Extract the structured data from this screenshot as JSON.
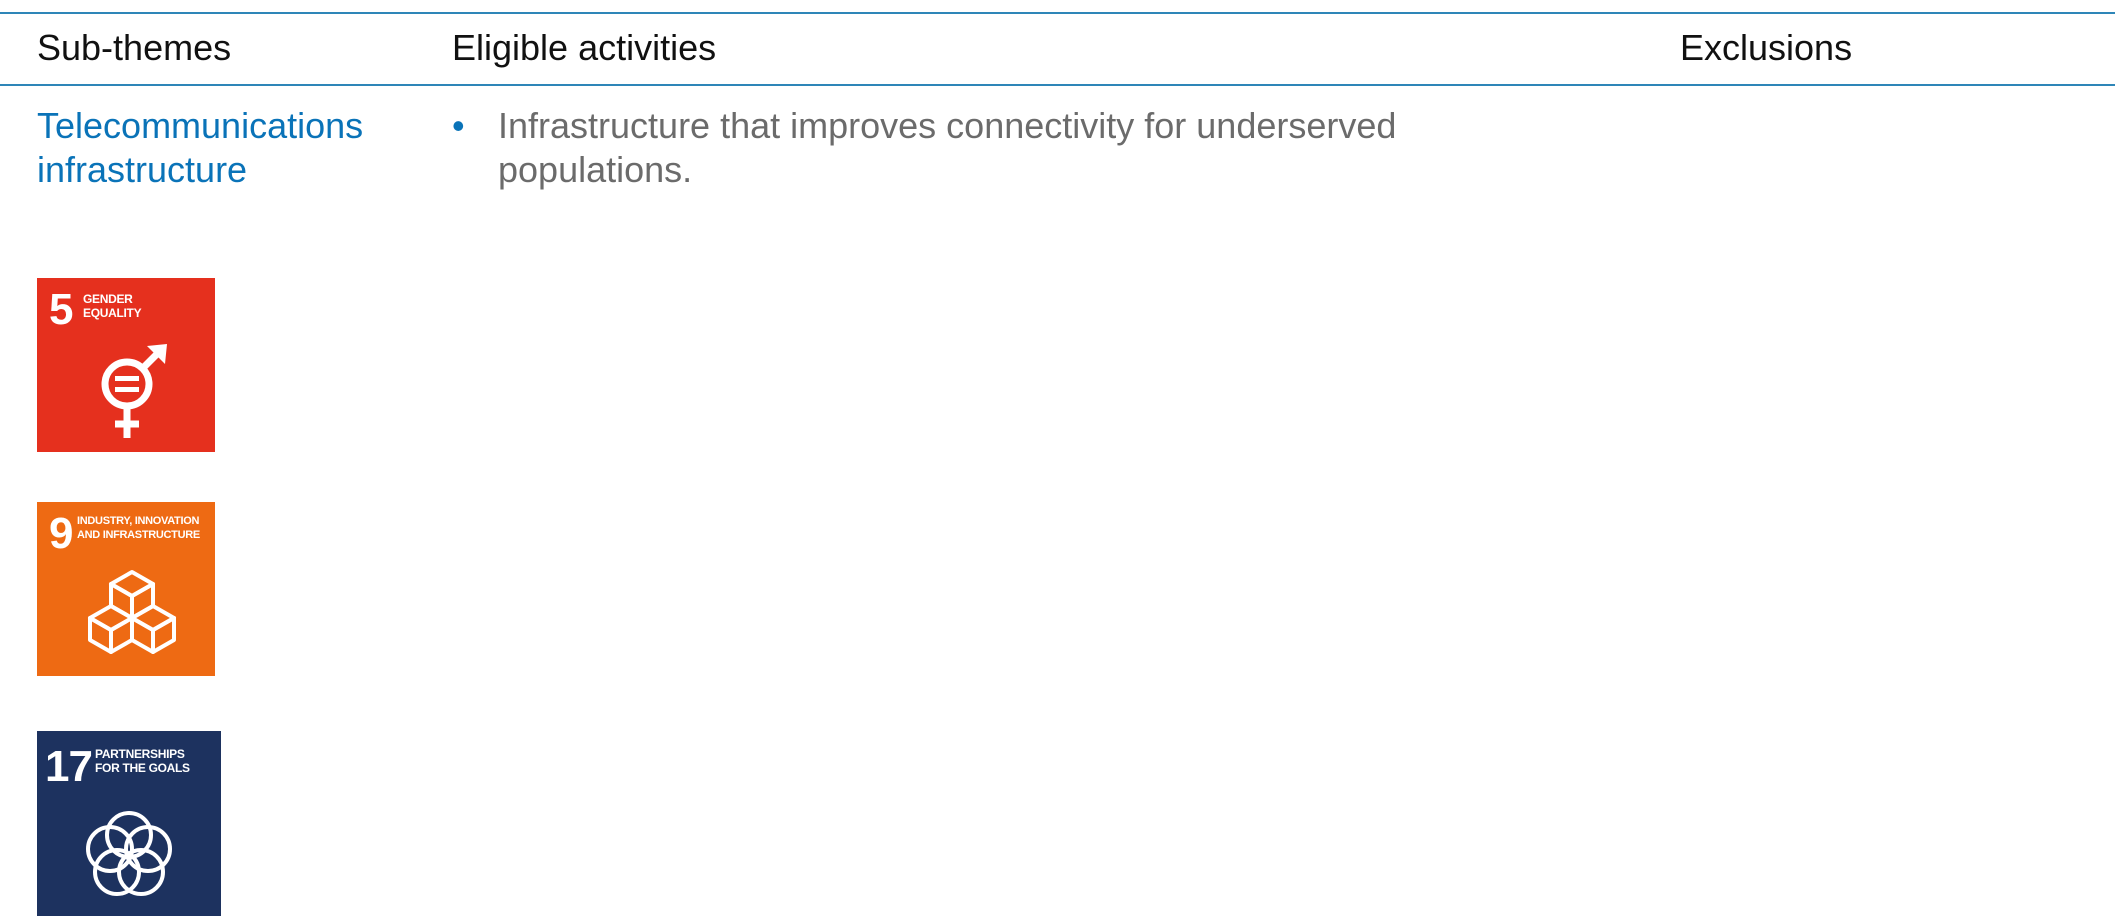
{
  "table": {
    "headers": [
      "Sub-themes",
      "Eligible activities",
      "Exclusions"
    ],
    "row": {
      "subtheme": "Telecommunications infrastructure",
      "bullet": "•",
      "activity": "Infrastructure that improves connectivity for underserved populations."
    }
  },
  "sdg_icons": [
    {
      "number": "5",
      "label_line1": "GENDER",
      "label_line2": "EQUALITY",
      "color": "#e5301e",
      "icon": "gender-equality-icon"
    },
    {
      "number": "9",
      "label_line1": "INDUSTRY, INNOVATION",
      "label_line2": "AND INFRASTRUCTURE",
      "color": "#ee6a13",
      "icon": "industry-cubes-icon"
    },
    {
      "number": "17",
      "label_line1": "PARTNERSHIPS",
      "label_line2": "FOR THE GOALS",
      "color": "#1d325f",
      "icon": "partnership-rings-icon"
    }
  ]
}
